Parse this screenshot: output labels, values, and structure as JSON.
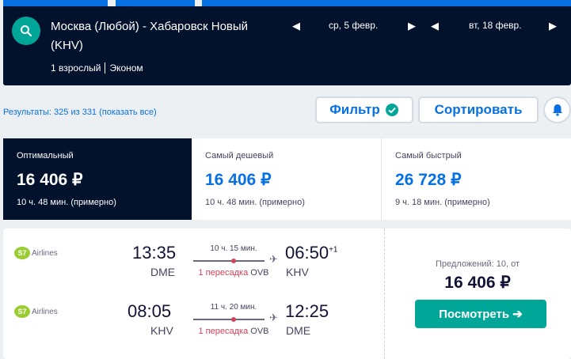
{
  "header": {
    "route": "Москва (Любой) - Хабаровск Новый (KHV)",
    "passengers": "1 взрослый",
    "cabin": "Эконом",
    "depart_date": "ср, 5 февр.",
    "return_date": "вт, 18 февр."
  },
  "toolbar": {
    "results_text": "Результаты: 325 из 331 (показать все)",
    "filter_label": "Фильтр",
    "sort_label": "Сортировать"
  },
  "sort_tabs": [
    {
      "label": "Оптимальный",
      "price": "16 406 ₽",
      "duration": "10 ч. 48 мин. (примерно)"
    },
    {
      "label": "Самый дешевый",
      "price": "16 406 ₽",
      "duration": "10 ч. 48 мин. (примерно)"
    },
    {
      "label": "Самый быстрый",
      "price": "26 728 ₽",
      "duration": "9 ч. 18 мин. (примерно)"
    }
  ],
  "card": {
    "legs": [
      {
        "airline": "Airlines",
        "dep_time": "13:35",
        "dep_code": "DME",
        "duration": "10 ч. 15 мин.",
        "stops": "1 пересадка",
        "stop_code": "OVB",
        "arr_time": "06:50",
        "day_offset": "+1",
        "arr_code": "KHV"
      },
      {
        "airline": "Airlines",
        "dep_time": "08:05",
        "dep_code": "KHV",
        "duration": "11 ч. 20 мин.",
        "stops": "1 пересадка",
        "stop_code": "OVB",
        "arr_time": "12:25",
        "day_offset": "",
        "arr_code": "DME"
      }
    ],
    "offers": "Предложений: 10, от",
    "price": "16 406 ₽",
    "view_label": "Посмотреть ➔"
  },
  "colors": {
    "navy": "#02122c",
    "blue": "#0770e3",
    "teal": "#00a698",
    "red": "#d1435b"
  }
}
